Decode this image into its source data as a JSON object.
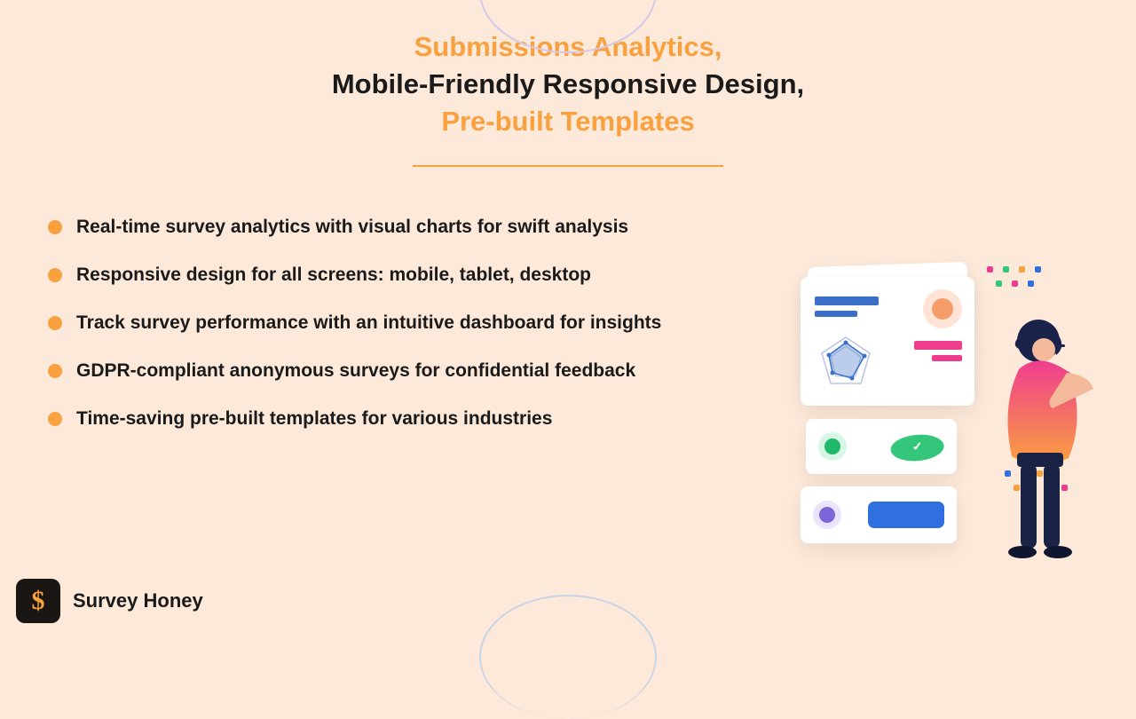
{
  "header": {
    "line1": "Submissions Analytics,",
    "line2": "Mobile-Friendly Responsive Design,",
    "line3": "Pre-built Templates"
  },
  "bullets": [
    "Real-time survey analytics with visual charts for swift analysis",
    "Responsive design for all screens: mobile, tablet, desktop",
    "Track survey performance with an intuitive dashboard for insights",
    "GDPR-compliant anonymous surveys for confidential feedback",
    "Time-saving pre-built templates for various industries"
  ],
  "brand": {
    "logo_glyph": "$",
    "name": "Survey Honey"
  },
  "colors": {
    "accent": "#f9a03f",
    "text": "#1a1a1a",
    "background": "#fde9d9"
  }
}
